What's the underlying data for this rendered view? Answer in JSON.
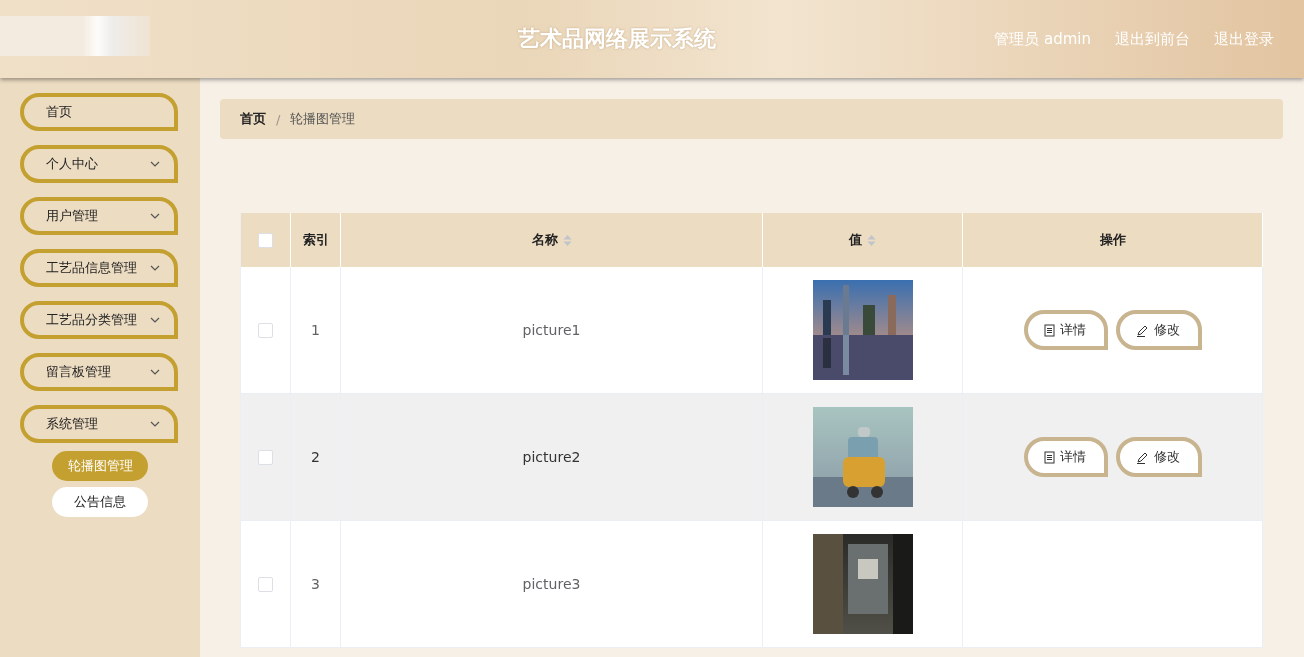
{
  "header": {
    "title": "艺术品网络展示系统",
    "links": [
      "管理员 admin",
      "退出到前台",
      "退出登录"
    ]
  },
  "sidebar": {
    "items": [
      {
        "label": "首页",
        "expandable": false
      },
      {
        "label": "个人中心",
        "expandable": true
      },
      {
        "label": "用户管理",
        "expandable": true
      },
      {
        "label": "工艺品信息管理",
        "expandable": true
      },
      {
        "label": "工艺品分类管理",
        "expandable": true
      },
      {
        "label": "留言板管理",
        "expandable": true
      },
      {
        "label": "系统管理",
        "expandable": true,
        "children": [
          {
            "label": "轮播图管理",
            "selected": true
          },
          {
            "label": "公告信息",
            "selected": false
          }
        ]
      }
    ]
  },
  "breadcrumb": {
    "items": [
      "首页",
      "轮播图管理"
    ],
    "separator": "/"
  },
  "table": {
    "select_all_checked": false,
    "columns": [
      {
        "label": "索引",
        "sortable": false
      },
      {
        "label": "名称",
        "sortable": true
      },
      {
        "label": "值",
        "sortable": true
      },
      {
        "label": "操作",
        "sortable": false
      }
    ],
    "rows": [
      {
        "index": "1",
        "name": "picture1",
        "value": {
          "kind": "picture"
        },
        "checked": false,
        "highlighted": false,
        "actions": [
          "详情",
          "修改"
        ]
      },
      {
        "index": "2",
        "name": "picture2",
        "value": {
          "kind": "picture"
        },
        "checked": false,
        "highlighted": true,
        "actions": [
          "详情",
          "修改"
        ]
      },
      {
        "index": "3",
        "name": "picture3",
        "value": {
          "kind": "picture"
        },
        "checked": false,
        "highlighted": false
      }
    ]
  }
}
